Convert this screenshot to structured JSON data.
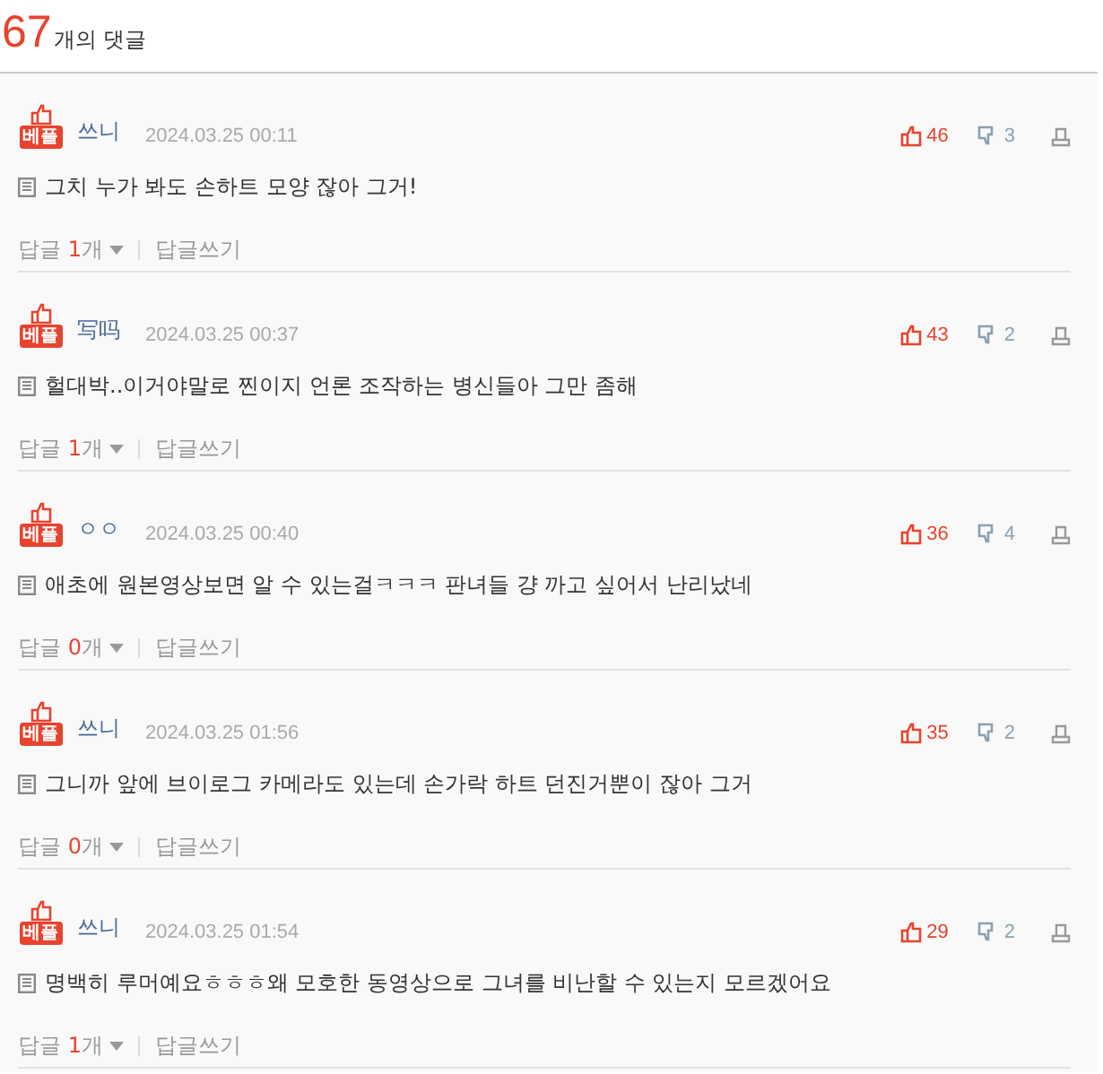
{
  "header": {
    "count": "67",
    "label": "개의 댓글"
  },
  "comments": [
    {
      "badge": "베플",
      "author": "쓰니",
      "date": "2024.03.25 00:11",
      "text": "그치 누가 봐도 손하트 모양 잖아 그거!",
      "likes": "46",
      "dislikes": "3",
      "reply_label": "답글",
      "reply_count": "1",
      "reply_unit": "개",
      "write_reply": "답글쓰기"
    },
    {
      "badge": "베플",
      "author": "写吗",
      "date": "2024.03.25 00:37",
      "text": "헐대박..이거야말로 찐이지 언론 조작하는 병신들아 그만 좀해",
      "likes": "43",
      "dislikes": "2",
      "reply_label": "답글",
      "reply_count": "1",
      "reply_unit": "개",
      "write_reply": "답글쓰기"
    },
    {
      "badge": "베플",
      "author": "ㅇㅇ",
      "date": "2024.03.25 00:40",
      "text": "애초에 원본영상보면 알 수 있는걸ㅋㅋㅋ 판녀들 걍 까고 싶어서 난리났네",
      "likes": "36",
      "dislikes": "4",
      "reply_label": "답글",
      "reply_count": "0",
      "reply_unit": "개",
      "write_reply": "답글쓰기"
    },
    {
      "badge": "베플",
      "author": "쓰니",
      "date": "2024.03.25 01:56",
      "text": "그니까 앞에 브이로그 카메라도 있는데 손가락 하트 던진거뿐이 잖아 그거",
      "likes": "35",
      "dislikes": "2",
      "reply_label": "답글",
      "reply_count": "0",
      "reply_unit": "개",
      "write_reply": "답글쓰기"
    },
    {
      "badge": "베플",
      "author": "쓰니",
      "date": "2024.03.25 01:54",
      "text": "명백히 루머예요ㅎㅎㅎ왜 모호한 동영상으로 그녀를 비난할 수 있는지 모르겠어요",
      "likes": "29",
      "dislikes": "2",
      "reply_label": "답글",
      "reply_count": "1",
      "reply_unit": "개",
      "write_reply": "답글쓰기"
    }
  ]
}
